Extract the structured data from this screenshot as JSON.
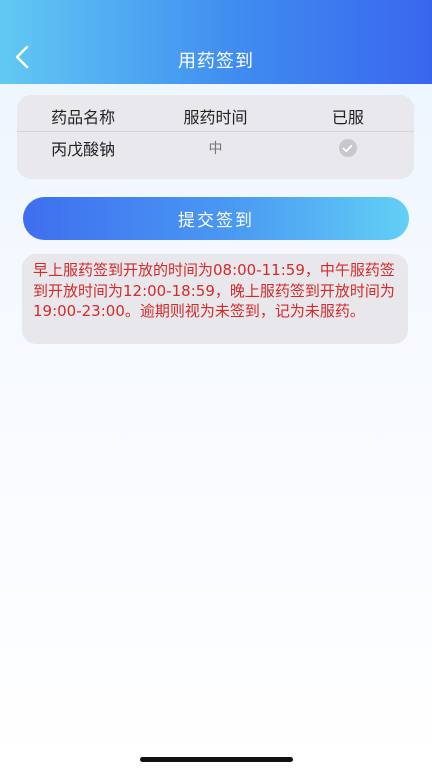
{
  "header": {
    "title": "用药签到",
    "back_icon": "chevron-left-icon"
  },
  "table": {
    "columns": [
      "药品名称",
      "服药时间",
      "已服"
    ],
    "rows": [
      {
        "name": "丙戊酸钠",
        "time": "中",
        "taken_icon": "check-circle-icon",
        "taken": true
      }
    ]
  },
  "actions": {
    "submit_label": "提交签到"
  },
  "notice": {
    "text": "早上服药签到开放的时间为08:00-11:59，中午服药签到开放时间为12:00-18:59，晚上服药签到开放时间为19:00-23:00。逾期则视为未签到，记为未服药。"
  },
  "colors": {
    "header_gradient": [
      "#62c9f3",
      "#3a66ee"
    ],
    "button_gradient": [
      "#3f6ef0",
      "#62d0f5"
    ],
    "notice_text": "#d42a2a"
  }
}
